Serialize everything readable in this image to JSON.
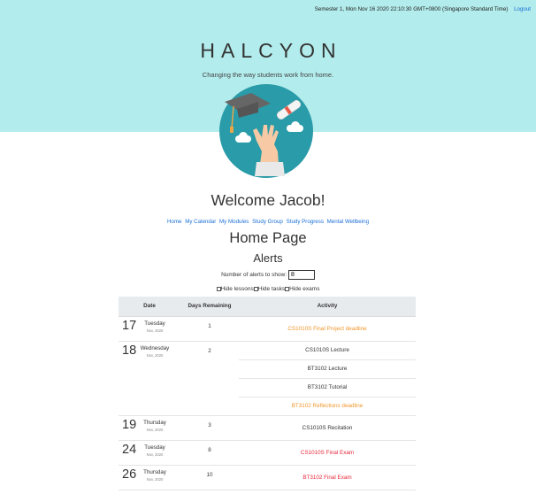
{
  "header": {
    "status_text": "Semester 1, Mon Nov 16 2020 22:10:30 GMT+0800 (Singapore Standard Time)",
    "logout_label": "Logout",
    "brand": "HALCYON",
    "tagline": "Changing the way students work from home."
  },
  "colors": {
    "hero_bg": "#b3ecec",
    "link": "#1a6fd6",
    "deadline": "#f0962a",
    "exam": "#e8283a",
    "logo_circle": "#2a9ba8"
  },
  "welcome": "Welcome Jacob!",
  "nav": {
    "items": [
      "Home",
      "My Calendar",
      "My Modules",
      "Study Group",
      "Study Progress",
      "Mental Wellbeing"
    ]
  },
  "page_title": "Home Page",
  "alerts": {
    "title": "Alerts",
    "count_label": "Number of alerts to show:",
    "count_value": "8",
    "filters": [
      "Hide lessons",
      "Hide tasks",
      "Hide exams"
    ]
  },
  "table": {
    "headers": [
      "Date",
      "Days Remaining",
      "Activity"
    ],
    "rows": [
      {
        "day": "17",
        "weekday": "Tuesday",
        "month": "Nov, 2020",
        "remaining": "1",
        "activities": [
          {
            "text": "CS1010S Final Project deadline",
            "kind": "deadline"
          }
        ]
      },
      {
        "day": "18",
        "weekday": "Wednesday",
        "month": "Nov, 2020",
        "remaining": "2",
        "activities": [
          {
            "text": "CS1010S Lecture",
            "kind": "lesson"
          },
          {
            "text": "BT3102 Lecture",
            "kind": "lesson"
          },
          {
            "text": "BT3102 Tutorial",
            "kind": "lesson"
          },
          {
            "text": "BT3102 Reflections deadline",
            "kind": "deadline"
          }
        ]
      },
      {
        "day": "19",
        "weekday": "Thursday",
        "month": "Nov, 2020",
        "remaining": "3",
        "activities": [
          {
            "text": "CS1010S Recitation",
            "kind": "lesson"
          }
        ]
      },
      {
        "day": "24",
        "weekday": "Tuesday",
        "month": "Nov, 2020",
        "remaining": "8",
        "activities": [
          {
            "text": "CS1010S Final Exam",
            "kind": "exam"
          }
        ]
      },
      {
        "day": "26",
        "weekday": "Thursday",
        "month": "Nov, 2020",
        "remaining": "10",
        "activities": [
          {
            "text": "BT3102 Final Exam",
            "kind": "exam"
          }
        ]
      }
    ]
  }
}
